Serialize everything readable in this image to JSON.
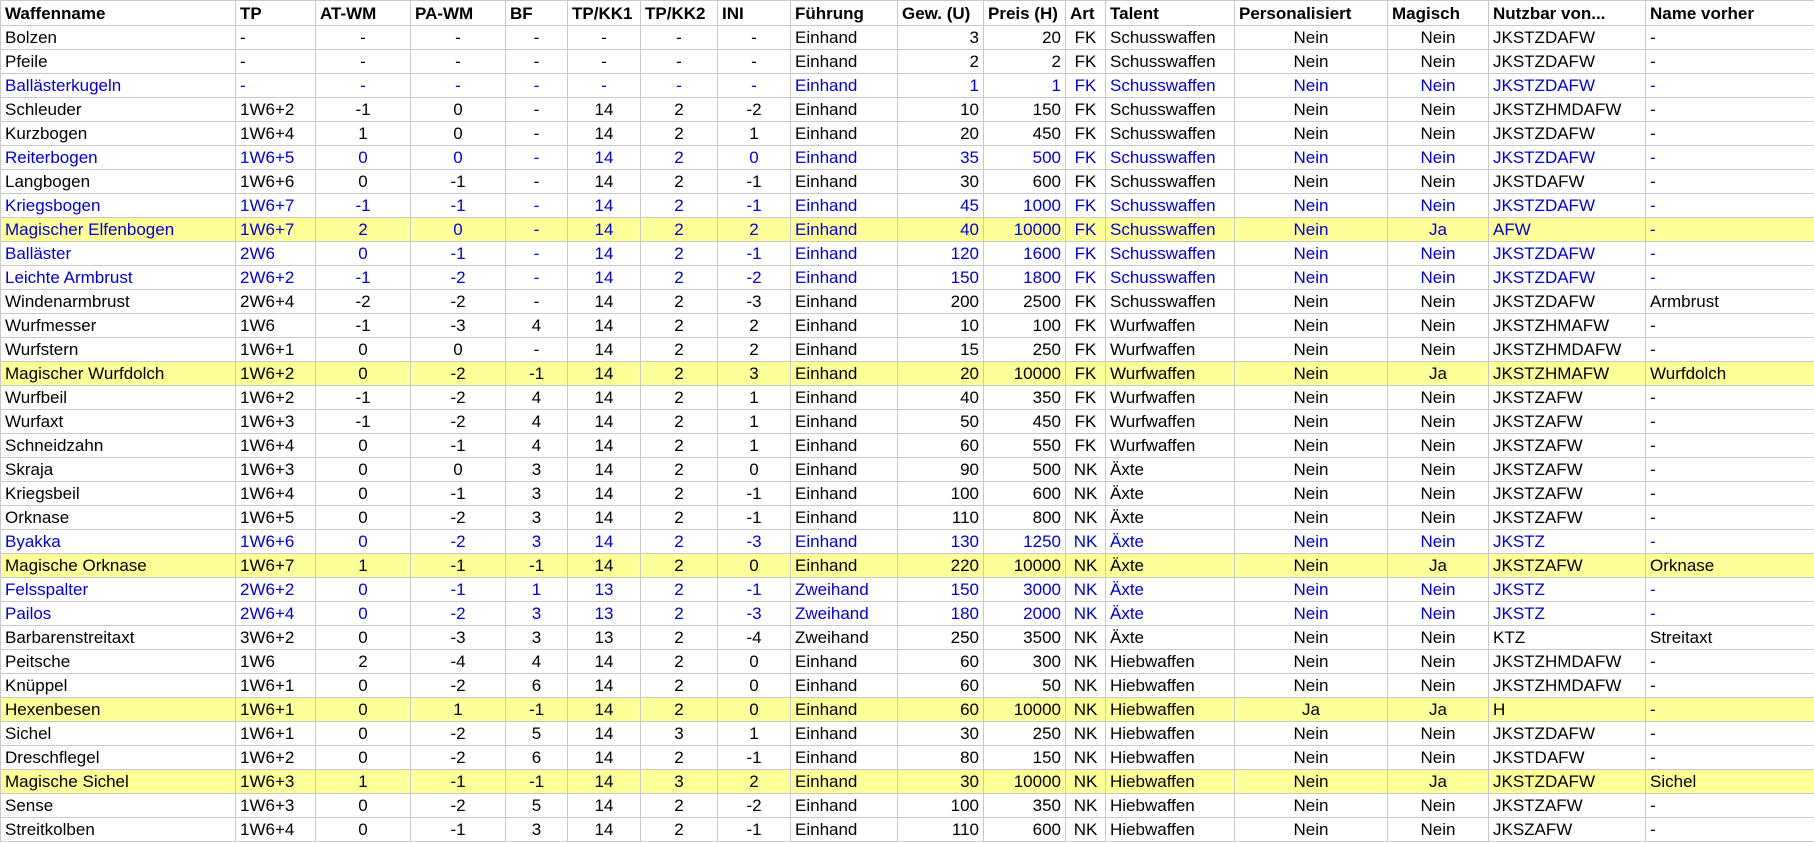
{
  "columns": [
    "Waffenname",
    "TP",
    "AT-WM",
    "PA-WM",
    "BF",
    "TP/KK1",
    "TP/KK2",
    "INI",
    "Führung",
    "Gew. (U)",
    "Preis (H)",
    "Art",
    "Talent",
    "Personalisiert",
    "Magisch",
    "Nutzbar von...",
    "Name vorher"
  ],
  "colors": {
    "blue_text": "#0000cc",
    "highlight": "#ffff99"
  },
  "rows": [
    {
      "style": "normal",
      "cells": [
        "Bolzen",
        "-",
        "-",
        "-",
        "-",
        "-",
        "-",
        "-",
        "Einhand",
        "3",
        "20",
        "FK",
        "Schusswaffen",
        "Nein",
        "Nein",
        "JKSTZDAFW",
        "-"
      ]
    },
    {
      "style": "normal",
      "cells": [
        "Pfeile",
        "-",
        "-",
        "-",
        "-",
        "-",
        "-",
        "-",
        "Einhand",
        "2",
        "2",
        "FK",
        "Schusswaffen",
        "Nein",
        "Nein",
        "JKSTZDAFW",
        "-"
      ]
    },
    {
      "style": "blue",
      "cells": [
        "Ballästerkugeln",
        "-",
        "-",
        "-",
        "-",
        "-",
        "-",
        "-",
        "Einhand",
        "1",
        "1",
        "FK",
        "Schusswaffen",
        "Nein",
        "Nein",
        "JKSTZDAFW",
        "-"
      ]
    },
    {
      "style": "normal",
      "cells": [
        "Schleuder",
        "1W6+2",
        "-1",
        "0",
        "-",
        "14",
        "2",
        "-2",
        "Einhand",
        "10",
        "150",
        "FK",
        "Schusswaffen",
        "Nein",
        "Nein",
        "JKSTZHMDAFW",
        "-"
      ]
    },
    {
      "style": "normal",
      "cells": [
        "Kurzbogen",
        "1W6+4",
        "1",
        "0",
        "-",
        "14",
        "2",
        "1",
        "Einhand",
        "20",
        "450",
        "FK",
        "Schusswaffen",
        "Nein",
        "Nein",
        "JKSTZDAFW",
        "-"
      ]
    },
    {
      "style": "blue",
      "cells": [
        "Reiterbogen",
        "1W6+5",
        "0",
        "0",
        "-",
        "14",
        "2",
        "0",
        "Einhand",
        "35",
        "500",
        "FK",
        "Schusswaffen",
        "Nein",
        "Nein",
        "JKSTZDAFW",
        "-"
      ]
    },
    {
      "style": "normal",
      "cells": [
        "Langbogen",
        "1W6+6",
        "0",
        "-1",
        "-",
        "14",
        "2",
        "-1",
        "Einhand",
        "30",
        "600",
        "FK",
        "Schusswaffen",
        "Nein",
        "Nein",
        "JKSTDAFW",
        "-"
      ]
    },
    {
      "style": "blue",
      "cells": [
        "Kriegsbogen",
        "1W6+7",
        "-1",
        "-1",
        "-",
        "14",
        "2",
        "-1",
        "Einhand",
        "45",
        "1000",
        "FK",
        "Schusswaffen",
        "Nein",
        "Nein",
        "JKSTZDAFW",
        "-"
      ]
    },
    {
      "style": "yellow blue",
      "cells": [
        "Magischer Elfenbogen",
        "1W6+7",
        "2",
        "0",
        "-",
        "14",
        "2",
        "2",
        "Einhand",
        "40",
        "10000",
        "FK",
        "Schusswaffen",
        "Nein",
        "Ja",
        "AFW",
        "-"
      ]
    },
    {
      "style": "blue",
      "cells": [
        "Balläster",
        "2W6",
        "0",
        "-1",
        "-",
        "14",
        "2",
        "-1",
        "Einhand",
        "120",
        "1600",
        "FK",
        "Schusswaffen",
        "Nein",
        "Nein",
        "JKSTZDAFW",
        "-"
      ]
    },
    {
      "style": "blue",
      "cells": [
        "Leichte Armbrust",
        "2W6+2",
        "-1",
        "-2",
        "-",
        "14",
        "2",
        "-2",
        "Einhand",
        "150",
        "1800",
        "FK",
        "Schusswaffen",
        "Nein",
        "Nein",
        "JKSTZDAFW",
        "-"
      ]
    },
    {
      "style": "normal",
      "cells": [
        "Windenarmbrust",
        "2W6+4",
        "-2",
        "-2",
        "-",
        "14",
        "2",
        "-3",
        "Einhand",
        "200",
        "2500",
        "FK",
        "Schusswaffen",
        "Nein",
        "Nein",
        "JKSTZDAFW",
        "Armbrust"
      ]
    },
    {
      "style": "normal",
      "cells": [
        "Wurfmesser",
        "1W6",
        "-1",
        "-3",
        "4",
        "14",
        "2",
        "2",
        "Einhand",
        "10",
        "100",
        "FK",
        "Wurfwaffen",
        "Nein",
        "Nein",
        "JKSTZHMAFW",
        "-"
      ]
    },
    {
      "style": "normal",
      "cells": [
        "Wurfstern",
        "1W6+1",
        "0",
        "0",
        "-",
        "14",
        "2",
        "2",
        "Einhand",
        "15",
        "250",
        "FK",
        "Wurfwaffen",
        "Nein",
        "Nein",
        "JKSTZHMDAFW",
        "-"
      ]
    },
    {
      "style": "yellow",
      "cells": [
        "Magischer Wurfdolch",
        "1W6+2",
        "0",
        "-2",
        "-1",
        "14",
        "2",
        "3",
        "Einhand",
        "20",
        "10000",
        "FK",
        "Wurfwaffen",
        "Nein",
        "Ja",
        "JKSTZHMAFW",
        "Wurfdolch"
      ]
    },
    {
      "style": "normal",
      "cells": [
        "Wurfbeil",
        "1W6+2",
        "-1",
        "-2",
        "4",
        "14",
        "2",
        "1",
        "Einhand",
        "40",
        "350",
        "FK",
        "Wurfwaffen",
        "Nein",
        "Nein",
        "JKSTZAFW",
        "-"
      ]
    },
    {
      "style": "normal",
      "cells": [
        "Wurfaxt",
        "1W6+3",
        "-1",
        "-2",
        "4",
        "14",
        "2",
        "1",
        "Einhand",
        "50",
        "450",
        "FK",
        "Wurfwaffen",
        "Nein",
        "Nein",
        "JKSTZAFW",
        "-"
      ]
    },
    {
      "style": "normal",
      "cells": [
        "Schneidzahn",
        "1W6+4",
        "0",
        "-1",
        "4",
        "14",
        "2",
        "1",
        "Einhand",
        "60",
        "550",
        "FK",
        "Wurfwaffen",
        "Nein",
        "Nein",
        "JKSTZAFW",
        "-"
      ]
    },
    {
      "style": "normal",
      "cells": [
        "Skraja",
        "1W6+3",
        "0",
        "0",
        "3",
        "14",
        "2",
        "0",
        "Einhand",
        "90",
        "500",
        "NK",
        "Äxte",
        "Nein",
        "Nein",
        "JKSTZAFW",
        "-"
      ]
    },
    {
      "style": "normal",
      "cells": [
        "Kriegsbeil",
        "1W6+4",
        "0",
        "-1",
        "3",
        "14",
        "2",
        "-1",
        "Einhand",
        "100",
        "600",
        "NK",
        "Äxte",
        "Nein",
        "Nein",
        "JKSTZAFW",
        "-"
      ]
    },
    {
      "style": "normal",
      "cells": [
        "Orknase",
        "1W6+5",
        "0",
        "-2",
        "3",
        "14",
        "2",
        "-1",
        "Einhand",
        "110",
        "800",
        "NK",
        "Äxte",
        "Nein",
        "Nein",
        "JKSTZAFW",
        "-"
      ]
    },
    {
      "style": "blue",
      "cells": [
        "Byakka",
        "1W6+6",
        "0",
        "-2",
        "3",
        "14",
        "2",
        "-3",
        "Einhand",
        "130",
        "1250",
        "NK",
        "Äxte",
        "Nein",
        "Nein",
        "JKSTZ",
        "-"
      ]
    },
    {
      "style": "yellow",
      "cells": [
        "Magische Orknase",
        "1W6+7",
        "1",
        "-1",
        "-1",
        "14",
        "2",
        "0",
        "Einhand",
        "220",
        "10000",
        "NK",
        "Äxte",
        "Nein",
        "Ja",
        "JKSTZAFW",
        "Orknase"
      ]
    },
    {
      "style": "blue",
      "cells": [
        "Felsspalter",
        "2W6+2",
        "0",
        "-1",
        "1",
        "13",
        "2",
        "-1",
        "Zweihand",
        "150",
        "3000",
        "NK",
        "Äxte",
        "Nein",
        "Nein",
        "JKSTZ",
        "-"
      ]
    },
    {
      "style": "blue",
      "cells": [
        "Pailos",
        "2W6+4",
        "0",
        "-2",
        "3",
        "13",
        "2",
        "-3",
        "Zweihand",
        "180",
        "2000",
        "NK",
        "Äxte",
        "Nein",
        "Nein",
        "JKSTZ",
        "-"
      ]
    },
    {
      "style": "normal",
      "cells": [
        "Barbarenstreitaxt",
        "3W6+2",
        "0",
        "-3",
        "3",
        "13",
        "2",
        "-4",
        "Zweihand",
        "250",
        "3500",
        "NK",
        "Äxte",
        "Nein",
        "Nein",
        "KTZ",
        "Streitaxt"
      ]
    },
    {
      "style": "normal",
      "cells": [
        "Peitsche",
        "1W6",
        "2",
        "-4",
        "4",
        "14",
        "2",
        "0",
        "Einhand",
        "60",
        "300",
        "NK",
        "Hiebwaffen",
        "Nein",
        "Nein",
        "JKSTZHMDAFW",
        "-"
      ]
    },
    {
      "style": "normal",
      "cells": [
        "Knüppel",
        "1W6+1",
        "0",
        "-2",
        "6",
        "14",
        "2",
        "0",
        "Einhand",
        "60",
        "50",
        "NK",
        "Hiebwaffen",
        "Nein",
        "Nein",
        "JKSTZHMDAFW",
        "-"
      ]
    },
    {
      "style": "yellow",
      "cells": [
        "Hexenbesen",
        "1W6+1",
        "0",
        "1",
        "-1",
        "14",
        "2",
        "0",
        "Einhand",
        "60",
        "10000",
        "NK",
        "Hiebwaffen",
        "Ja",
        "Ja",
        "H",
        "-"
      ]
    },
    {
      "style": "normal",
      "cells": [
        "Sichel",
        "1W6+1",
        "0",
        "-2",
        "5",
        "14",
        "3",
        "1",
        "Einhand",
        "30",
        "250",
        "NK",
        "Hiebwaffen",
        "Nein",
        "Nein",
        "JKSTZDAFW",
        "-"
      ]
    },
    {
      "style": "normal",
      "cells": [
        "Dreschflegel",
        "1W6+2",
        "0",
        "-2",
        "6",
        "14",
        "2",
        "-1",
        "Einhand",
        "80",
        "150",
        "NK",
        "Hiebwaffen",
        "Nein",
        "Nein",
        "JKSTDAFW",
        "-"
      ]
    },
    {
      "style": "yellow",
      "cells": [
        "Magische Sichel",
        "1W6+3",
        "1",
        "-1",
        "-1",
        "14",
        "3",
        "2",
        "Einhand",
        "30",
        "10000",
        "NK",
        "Hiebwaffen",
        "Nein",
        "Ja",
        "JKSTZDAFW",
        "Sichel"
      ]
    },
    {
      "style": "normal",
      "cells": [
        "Sense",
        "1W6+3",
        "0",
        "-2",
        "5",
        "14",
        "2",
        "-2",
        "Einhand",
        "100",
        "350",
        "NK",
        "Hiebwaffen",
        "Nein",
        "Nein",
        "JKSTZAFW",
        "-"
      ]
    },
    {
      "style": "normal",
      "cells": [
        "Streitkolben",
        "1W6+4",
        "0",
        "-1",
        "3",
        "14",
        "2",
        "-1",
        "Einhand",
        "110",
        "600",
        "NK",
        "Hiebwaffen",
        "Nein",
        "Nein",
        "JKSZAFW",
        "-"
      ]
    }
  ]
}
